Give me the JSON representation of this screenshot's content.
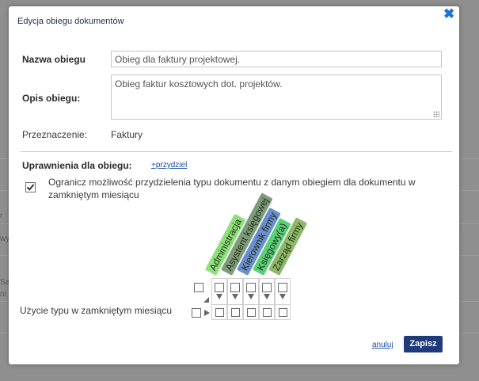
{
  "dialog": {
    "title": "Edycja obiegu dokumentów",
    "close_icon": "close-icon"
  },
  "form": {
    "name_label": "Nazwa obiegu",
    "name_value": "Obieg dla faktury projektowej.",
    "desc_label": "Opis obiegu:",
    "desc_value": "Obieg faktur kosztowych dot. projektów.",
    "purpose_label": "Przeznaczenie:",
    "purpose_value": "Faktury"
  },
  "permissions": {
    "label": "Uprawnienia dla obiegu:",
    "assign_link": "+przydziel",
    "restrict_checked": true,
    "restrict_text": "Ogranicz możliwość przydzielenia typu dokumentu z danym obiegiem dla dokumentu w zamkniętym miesiącu",
    "row_label": "Użycie typu w zamkniętym miesiącu",
    "roles": [
      {
        "name": "Administracja",
        "color": "#8ee07c"
      },
      {
        "name": "Asystent księgowej",
        "color": "#7e9c7c"
      },
      {
        "name": "Kierownik firmy",
        "color": "#6b8fce"
      },
      {
        "name": "Księgowy(a)",
        "color": "#5bd07a"
      },
      {
        "name": "Zarząd firmy",
        "color": "#8fb86a"
      }
    ]
  },
  "footer": {
    "cancel_label": "anuluj",
    "save_label": "Zapisz"
  },
  "background": {
    "fragments": [
      "r",
      "wy",
      "Sa",
      "ni"
    ]
  },
  "colors": {
    "accent": "#1f3c7a",
    "close": "#1a73d6",
    "link": "#1a4fa8"
  }
}
